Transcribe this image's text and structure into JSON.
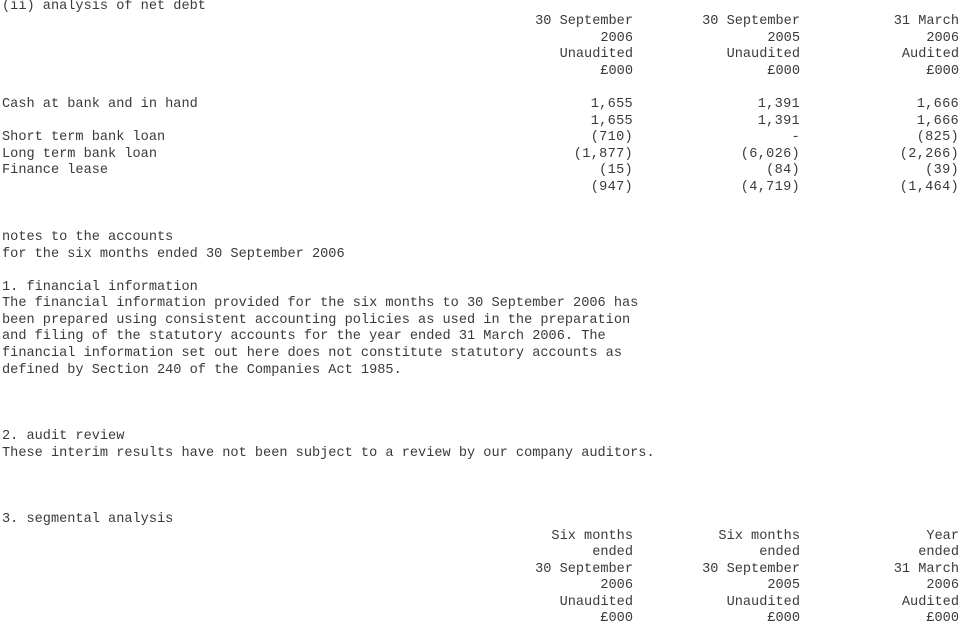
{
  "net_debt": {
    "title": "(ii) analysis of net debt",
    "columns": [
      {
        "line1": "30 September",
        "line2": "2006",
        "line3": "Unaudited",
        "line4": "£000"
      },
      {
        "line1": "30 September",
        "line2": "2005",
        "line3": "Unaudited",
        "line4": "£000"
      },
      {
        "line1": "31 March",
        "line2": "2006",
        "line3": "Audited",
        "line4": "£000"
      }
    ],
    "rows": [
      {
        "label": "Cash at bank and in hand",
        "values": [
          "1,655",
          "1,391",
          "1,666"
        ]
      },
      {
        "label": "",
        "values": [
          "1,655",
          "1,391",
          "1,666"
        ]
      },
      {
        "label": "Short term bank loan",
        "values": [
          "(710)",
          "-",
          "(825)"
        ]
      },
      {
        "label": "Long term bank loan",
        "values": [
          "(1,877)",
          "(6,026)",
          "(2,266)"
        ]
      },
      {
        "label": "Finance lease",
        "values": [
          "(15)",
          "(84)",
          "(39)"
        ]
      },
      {
        "label": "",
        "values": [
          "(947)",
          "(4,719)",
          "(1,464)"
        ]
      }
    ]
  },
  "notes": {
    "heading": "notes to the accounts",
    "subheading": "for the six months ended 30 September 2006",
    "sections": [
      {
        "title": "1. financial information",
        "lines": [
          "The financial information provided for the six months to 30 September 2006 has",
          "been prepared using consistent accounting policies as used in the preparation",
          "and filing of the statutory accounts for the year ended 31 March 2006. The",
          "financial information set out here does not constitute statutory accounts as",
          "defined by Section 240 of the Companies Act 1985."
        ]
      },
      {
        "title": "2. audit review",
        "lines": [
          "These interim results have not been subject to a review by our company auditors."
        ]
      },
      {
        "title": "3. segmental analysis",
        "lines": []
      }
    ]
  },
  "segmental": {
    "columns": [
      {
        "line1": "Six months",
        "line2": "ended",
        "line3": "30 September",
        "line4": "2006",
        "line5": "Unaudited",
        "line6": "£000"
      },
      {
        "line1": "Six months",
        "line2": "ended",
        "line3": "30 September",
        "line4": "2005",
        "line5": "Unaudited",
        "line6": "£000"
      },
      {
        "line1": "Year",
        "line2": "ended",
        "line3": "31 March",
        "line4": "2006",
        "line5": "Audited",
        "line6": "£000"
      }
    ]
  }
}
